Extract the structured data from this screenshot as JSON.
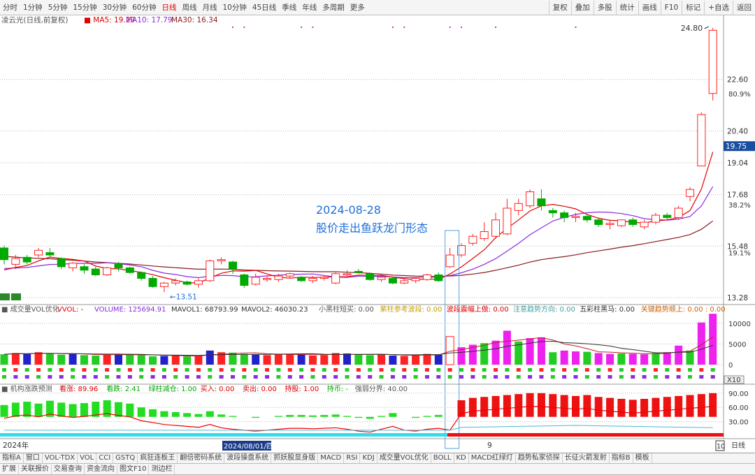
{
  "toolbar": {
    "periods": [
      "分时",
      "1分钟",
      "5分钟",
      "15分钟",
      "30分钟",
      "60分钟",
      "日线",
      "周线",
      "月线",
      "10分钟",
      "45日线",
      "季线",
      "年线",
      "多周期",
      "更多"
    ],
    "active_period": "日线",
    "right_buttons": [
      "复权",
      "叠加",
      "多股",
      "统计",
      "画线",
      "F10",
      "标记",
      "+自选",
      "返回"
    ]
  },
  "main_panel": {
    "title": "凌云光(日线,前复权)",
    "ma5_label": "MA5: 19.29",
    "ma10_label": "MA10: 17.79",
    "ma30_label": "MA30: 16.34",
    "current_price": "19.75",
    "high_label": "24.80",
    "low_label": "13.51",
    "annotation_date": "2024-08-28",
    "annotation_text": "股价走出鱼跃龙门形态",
    "y_ticks": [
      "22.60",
      "20.40",
      "19.04",
      "17.68",
      "15.48",
      "13.28"
    ],
    "pct_ticks": [
      "80.9%",
      "38.2%",
      "19.1%"
    ]
  },
  "vol_panel": {
    "title": "成交量VOL优化",
    "vvol": "VVOL: -",
    "volume": "VOLUME: 125694.91",
    "mavol1": "MAVOL1: 68793.99",
    "mavol2": "MAVOL2: 46030.23",
    "extra": [
      "小黑柱短买: 0.00",
      "紫柱参考波段: 0.00",
      "波段震幅上做: 0.00",
      "注意趋势方向: 0.00",
      "五彩柱黑马: 0.00",
      "关键趋势顺上: 0.00 : 0.00"
    ],
    "y_ticks": [
      "10000",
      "5000",
      "0"
    ],
    "x10": "X10"
  },
  "ind_panel": {
    "title": "机构涨跌预测",
    "items": [
      "看涨: 89.96",
      "看跌: 2.41",
      "绿柱减仓: 1.00",
      "买入: 0.00",
      "卖出: 0.00",
      "持股: 1.00",
      "持币: -",
      "强弱分界: 40.00"
    ],
    "y_ticks": [
      "90.00",
      "60.00",
      "30.00"
    ]
  },
  "xaxis": {
    "year": "2024年",
    "cursor_date": "2024/08/01/四",
    "month_mark": "9",
    "right_box": "10",
    "right_label": "日线"
  },
  "bottom1": [
    "指标A",
    "窗口",
    "VOL-TDX",
    "VOL",
    "CCI",
    "GSTQ",
    "疯狂连板王",
    "翻倍密码系统",
    "波段操盘系统",
    "抓妖股显身版",
    "MACD",
    "RSI",
    "KDJ",
    "成交量VOL优化",
    "BOLL",
    "KD",
    "MACD红绿灯",
    "趋势私家侦探",
    "长征火箭发射",
    "指标B",
    "模板"
  ],
  "bottom2": [
    "扩展",
    "关联报价",
    "交易查询",
    "资金流向",
    "图文F10",
    "测边栏"
  ],
  "colors": {
    "up": "#ff2222",
    "down": "#00aa00",
    "ma5": "#e00000",
    "ma10": "#8a2be2",
    "ma30": "#8b1a1a",
    "grid": "#bbbbbb",
    "annot": "#1e6fd9"
  },
  "chart_data": {
    "type": "candlestick",
    "candles": [
      {
        "o": 15.4,
        "c": 14.9,
        "h": 15.5,
        "l": 14.7
      },
      {
        "o": 14.7,
        "c": 14.95,
        "h": 15.1,
        "l": 14.5
      },
      {
        "o": 15.0,
        "c": 14.8,
        "h": 15.1,
        "l": 14.7
      },
      {
        "o": 15.1,
        "c": 15.3,
        "h": 15.4,
        "l": 15.0
      },
      {
        "o": 15.2,
        "c": 15.1,
        "h": 15.4,
        "l": 15.0
      },
      {
        "o": 14.95,
        "c": 14.6,
        "h": 15.0,
        "l": 14.5
      },
      {
        "o": 14.55,
        "c": 14.75,
        "h": 14.8,
        "l": 14.4
      },
      {
        "o": 14.6,
        "c": 14.45,
        "h": 14.7,
        "l": 14.3
      },
      {
        "o": 14.5,
        "c": 14.25,
        "h": 14.6,
        "l": 14.2
      },
      {
        "o": 14.25,
        "c": 14.55,
        "h": 14.6,
        "l": 14.2
      },
      {
        "o": 14.7,
        "c": 14.55,
        "h": 14.8,
        "l": 14.4
      },
      {
        "o": 14.55,
        "c": 14.35,
        "h": 14.6,
        "l": 14.3
      },
      {
        "o": 14.35,
        "c": 14.1,
        "h": 14.4,
        "l": 14.0
      },
      {
        "o": 14.1,
        "c": 13.75,
        "h": 14.2,
        "l": 13.7
      },
      {
        "o": 13.75,
        "c": 13.9,
        "h": 13.95,
        "l": 13.51
      },
      {
        "o": 13.9,
        "c": 14.0,
        "h": 14.1,
        "l": 13.8
      },
      {
        "o": 13.95,
        "c": 13.85,
        "h": 14.0,
        "l": 13.8
      },
      {
        "o": 13.85,
        "c": 14.0,
        "h": 14.1,
        "l": 13.7
      },
      {
        "o": 14.0,
        "c": 14.85,
        "h": 14.9,
        "l": 13.95
      },
      {
        "o": 14.85,
        "c": 14.9,
        "h": 15.0,
        "l": 14.7
      },
      {
        "o": 14.8,
        "c": 14.5,
        "h": 14.85,
        "l": 14.3
      },
      {
        "o": 14.25,
        "c": 13.8,
        "h": 14.3,
        "l": 13.7
      },
      {
        "o": 13.85,
        "c": 14.15,
        "h": 14.3,
        "l": 13.8
      },
      {
        "o": 14.05,
        "c": 14.1,
        "h": 14.2,
        "l": 13.95
      },
      {
        "o": 14.05,
        "c": 14.2,
        "h": 14.3,
        "l": 13.95
      },
      {
        "o": 14.2,
        "c": 14.3,
        "h": 14.35,
        "l": 14.1
      },
      {
        "o": 14.15,
        "c": 14.0,
        "h": 14.2,
        "l": 13.95
      },
      {
        "o": 14.0,
        "c": 14.1,
        "h": 14.2,
        "l": 13.9
      },
      {
        "o": 14.1,
        "c": 14.15,
        "h": 14.2,
        "l": 14.0
      },
      {
        "o": 13.9,
        "c": 14.3,
        "h": 14.4,
        "l": 13.85
      },
      {
        "o": 14.25,
        "c": 14.3,
        "h": 14.45,
        "l": 14.2
      },
      {
        "o": 14.4,
        "c": 14.35,
        "h": 14.5,
        "l": 14.3
      },
      {
        "o": 14.3,
        "c": 14.05,
        "h": 14.35,
        "l": 14.0
      },
      {
        "o": 14.05,
        "c": 14.15,
        "h": 14.3,
        "l": 13.95
      },
      {
        "o": 14.1,
        "c": 13.9,
        "h": 14.15,
        "l": 13.85
      },
      {
        "o": 13.9,
        "c": 14.0,
        "h": 14.1,
        "l": 13.85
      },
      {
        "o": 14.0,
        "c": 14.1,
        "h": 14.15,
        "l": 13.9
      },
      {
        "o": 14.05,
        "c": 14.25,
        "h": 14.3,
        "l": 14.0
      },
      {
        "o": 14.25,
        "c": 14.0,
        "h": 14.35,
        "l": 13.95
      },
      {
        "o": 14.6,
        "c": 15.1,
        "h": 15.4,
        "l": 14.55
      },
      {
        "o": 15.1,
        "c": 15.5,
        "h": 15.6,
        "l": 15.0
      },
      {
        "o": 15.6,
        "c": 15.9,
        "h": 16.0,
        "l": 15.5
      },
      {
        "o": 15.8,
        "c": 16.1,
        "h": 16.5,
        "l": 15.7
      },
      {
        "o": 15.9,
        "c": 16.6,
        "h": 16.9,
        "l": 15.8
      },
      {
        "o": 16.0,
        "c": 17.1,
        "h": 17.5,
        "l": 15.95
      },
      {
        "o": 17.0,
        "c": 17.3,
        "h": 17.5,
        "l": 16.8
      },
      {
        "o": 17.2,
        "c": 17.8,
        "h": 17.9,
        "l": 17.1
      },
      {
        "o": 17.5,
        "c": 17.2,
        "h": 17.9,
        "l": 17.0
      },
      {
        "o": 17.0,
        "c": 16.9,
        "h": 17.1,
        "l": 16.7
      },
      {
        "o": 16.9,
        "c": 16.7,
        "h": 17.0,
        "l": 16.5
      },
      {
        "o": 16.7,
        "c": 16.75,
        "h": 16.9,
        "l": 16.5
      },
      {
        "o": 16.75,
        "c": 16.6,
        "h": 16.85,
        "l": 16.5
      },
      {
        "o": 16.6,
        "c": 16.4,
        "h": 16.7,
        "l": 16.3
      },
      {
        "o": 16.4,
        "c": 16.45,
        "h": 16.6,
        "l": 16.2
      },
      {
        "o": 16.35,
        "c": 16.6,
        "h": 16.6,
        "l": 16.3
      },
      {
        "o": 16.6,
        "c": 16.4,
        "h": 16.7,
        "l": 16.3
      },
      {
        "o": 16.3,
        "c": 16.5,
        "h": 16.6,
        "l": 16.2
      },
      {
        "o": 16.5,
        "c": 16.8,
        "h": 16.9,
        "l": 16.4
      },
      {
        "o": 16.8,
        "c": 16.7,
        "h": 16.9,
        "l": 16.6
      },
      {
        "o": 16.7,
        "c": 17.1,
        "h": 17.2,
        "l": 16.6
      },
      {
        "o": 17.6,
        "c": 17.9,
        "h": 18.0,
        "l": 17.4
      },
      {
        "o": 18.9,
        "c": 21.1,
        "h": 21.2,
        "l": 18.9
      },
      {
        "o": 22.0,
        "c": 24.7,
        "h": 24.8,
        "l": 21.7
      }
    ],
    "volume": [
      2500,
      2800,
      2600,
      3000,
      2700,
      2400,
      2600,
      2300,
      2200,
      2400,
      2600,
      2400,
      2300,
      2000,
      2100,
      2200,
      2000,
      2100,
      3400,
      3000,
      2900,
      2600,
      2400,
      2300,
      2500,
      2600,
      2400,
      2200,
      2300,
      2800,
      2700,
      2500,
      2300,
      2400,
      2200,
      2100,
      2300,
      2600,
      2400,
      6800,
      4200,
      4800,
      5200,
      5800,
      8200,
      5600,
      6400,
      6600,
      3000,
      3400,
      3200,
      3100,
      2800,
      2600,
      2700,
      2600,
      2500,
      2800,
      3000,
      4600,
      3400,
      10200,
      12300
    ],
    "forecast_dark": [
      65,
      70,
      72,
      68,
      74,
      70,
      67,
      69,
      72,
      75,
      71,
      68,
      60,
      56,
      52,
      50,
      48,
      46,
      52,
      45,
      42,
      40,
      38,
      40,
      42,
      44,
      44,
      43,
      44,
      45,
      42,
      38,
      36,
      42,
      48,
      40,
      38,
      42,
      44,
      40,
      75,
      80,
      82,
      84,
      86,
      88,
      90,
      90,
      88,
      86,
      84,
      86,
      82,
      80,
      78,
      76,
      78,
      80,
      82,
      84,
      86,
      88,
      89.96
    ]
  }
}
